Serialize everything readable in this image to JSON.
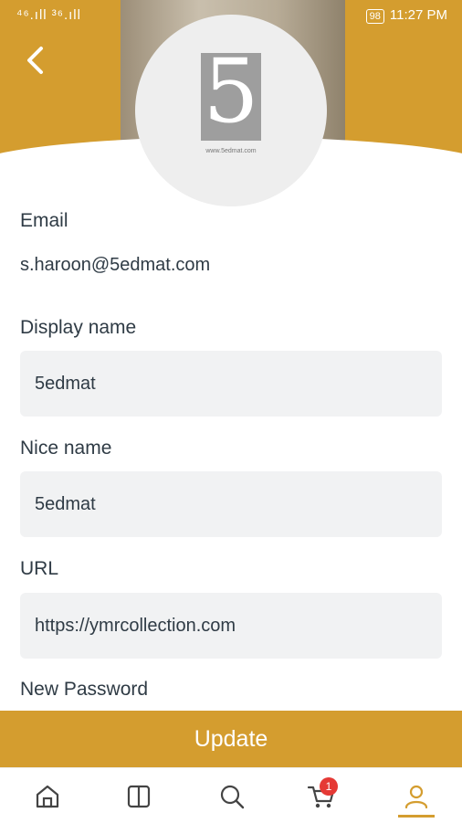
{
  "status_bar": {
    "signal": "⁴⁶.ıll ³⁶.ıll",
    "battery": "98",
    "time": "11:27 PM"
  },
  "profile": {
    "logo_digit": "5",
    "logo_caption": "www.5edmat.com"
  },
  "form": {
    "email_label": "Email",
    "email_value": "s.haroon@5edmat.com",
    "display_name_label": "Display name",
    "display_name_value": "5edmat",
    "nice_name_label": "Nice name",
    "nice_name_value": "5edmat",
    "url_label": "URL",
    "url_value": "https://ymrcollection.com",
    "new_password_label": "New Password"
  },
  "update_label": "Update",
  "tabbar": {
    "cart_count": "1",
    "active": "profile"
  },
  "colors": {
    "accent": "#d49d2f",
    "badge": "#e53935",
    "field_bg": "#f1f2f3"
  }
}
